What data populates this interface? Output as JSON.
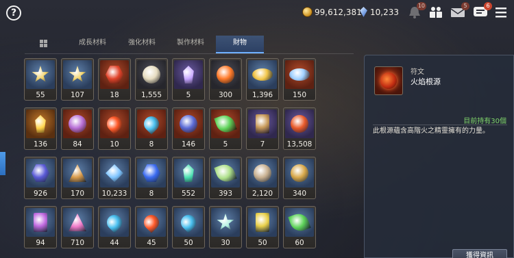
{
  "header": {
    "help_glyph": "?",
    "gold": "99,612,381",
    "gems": "10,233",
    "icons": [
      {
        "name": "bell-icon",
        "badge": "10"
      },
      {
        "name": "team-icon",
        "badge": ""
      },
      {
        "name": "mail-icon",
        "badge": "5"
      },
      {
        "name": "chat-icon",
        "badge": "6"
      }
    ]
  },
  "tabs": [
    {
      "label": "成長材料",
      "active": false
    },
    {
      "label": "強化材料",
      "active": false
    },
    {
      "label": "製作材料",
      "active": false
    },
    {
      "label": "財物",
      "active": true
    }
  ],
  "items": [
    {
      "count": "55",
      "icon": "star-shard-icon",
      "bg": "bg-blue"
    },
    {
      "count": "107",
      "icon": "star-shard-icon",
      "bg": "bg-blue"
    },
    {
      "count": "18",
      "icon": "red-rune-cube-icon",
      "bg": "bg-red"
    },
    {
      "count": "1,555",
      "icon": "sun-medallion-icon",
      "bg": "bg-dark"
    },
    {
      "count": "5",
      "icon": "crystal-cluster-icon",
      "bg": "bg-purple"
    },
    {
      "count": "300",
      "icon": "fire-orb-icon",
      "bg": "bg-dark"
    },
    {
      "count": "1,396",
      "icon": "golden-eye-icon",
      "bg": "bg-blue"
    },
    {
      "count": "150",
      "icon": "silver-eye-icon",
      "bg": "bg-red"
    },
    {
      "count": "136",
      "icon": "gold-crystal-icon",
      "bg": "bg-orange"
    },
    {
      "count": "84",
      "icon": "purple-seal-icon",
      "bg": "bg-red"
    },
    {
      "count": "10",
      "icon": "fire-rune-icon",
      "bg": "bg-red"
    },
    {
      "count": "8",
      "icon": "water-rune-icon",
      "bg": "bg-red"
    },
    {
      "count": "146",
      "icon": "blue-seal-icon",
      "bg": "bg-red"
    },
    {
      "count": "5",
      "icon": "tree-rune-icon",
      "bg": "bg-red"
    },
    {
      "count": "7",
      "icon": "treasure-map-icon",
      "bg": "bg-purple"
    },
    {
      "count": "13,508",
      "icon": "flame-emblem-icon",
      "bg": "bg-purple"
    },
    {
      "count": "926",
      "icon": "lantern-icon",
      "bg": "bg-blue"
    },
    {
      "count": "170",
      "icon": "horn-relic-icon",
      "bg": "bg-blue"
    },
    {
      "count": "10,233",
      "icon": "blue-gem-icon",
      "bg": "bg-blue"
    },
    {
      "count": "8",
      "icon": "blue-ore-icon",
      "bg": "bg-blue"
    },
    {
      "count": "552",
      "icon": "green-crystal-icon",
      "bg": "bg-blue"
    },
    {
      "count": "393",
      "icon": "leaf-icon",
      "bg": "bg-blue"
    },
    {
      "count": "2,120",
      "icon": "bronze-coin-icon",
      "bg": "bg-blue"
    },
    {
      "count": "340",
      "icon": "gold-coin-icon",
      "bg": "bg-blue"
    },
    {
      "count": "94",
      "icon": "tarot-card-icon",
      "bg": "bg-blue"
    },
    {
      "count": "710",
      "icon": "pink-crystal-icon",
      "bg": "bg-blue"
    },
    {
      "count": "44",
      "icon": "water-rune-icon",
      "bg": "bg-blue"
    },
    {
      "count": "45",
      "icon": "fire-rune-icon",
      "bg": "bg-blue"
    },
    {
      "count": "50",
      "icon": "water-rune-icon",
      "bg": "bg-blue"
    },
    {
      "count": "30",
      "icon": "star-burst-icon",
      "bg": "bg-blue"
    },
    {
      "count": "50",
      "icon": "gold-card-icon",
      "bg": "bg-blue"
    },
    {
      "count": "60",
      "icon": "tree-rune-icon",
      "bg": "bg-blue"
    }
  ],
  "detail": {
    "category": "符文",
    "name": "火焰根源",
    "owned": "目前持有30個",
    "description": "此根源蘊含高階火之精靈擁有的力量。",
    "info_button": "獲得資訊"
  }
}
